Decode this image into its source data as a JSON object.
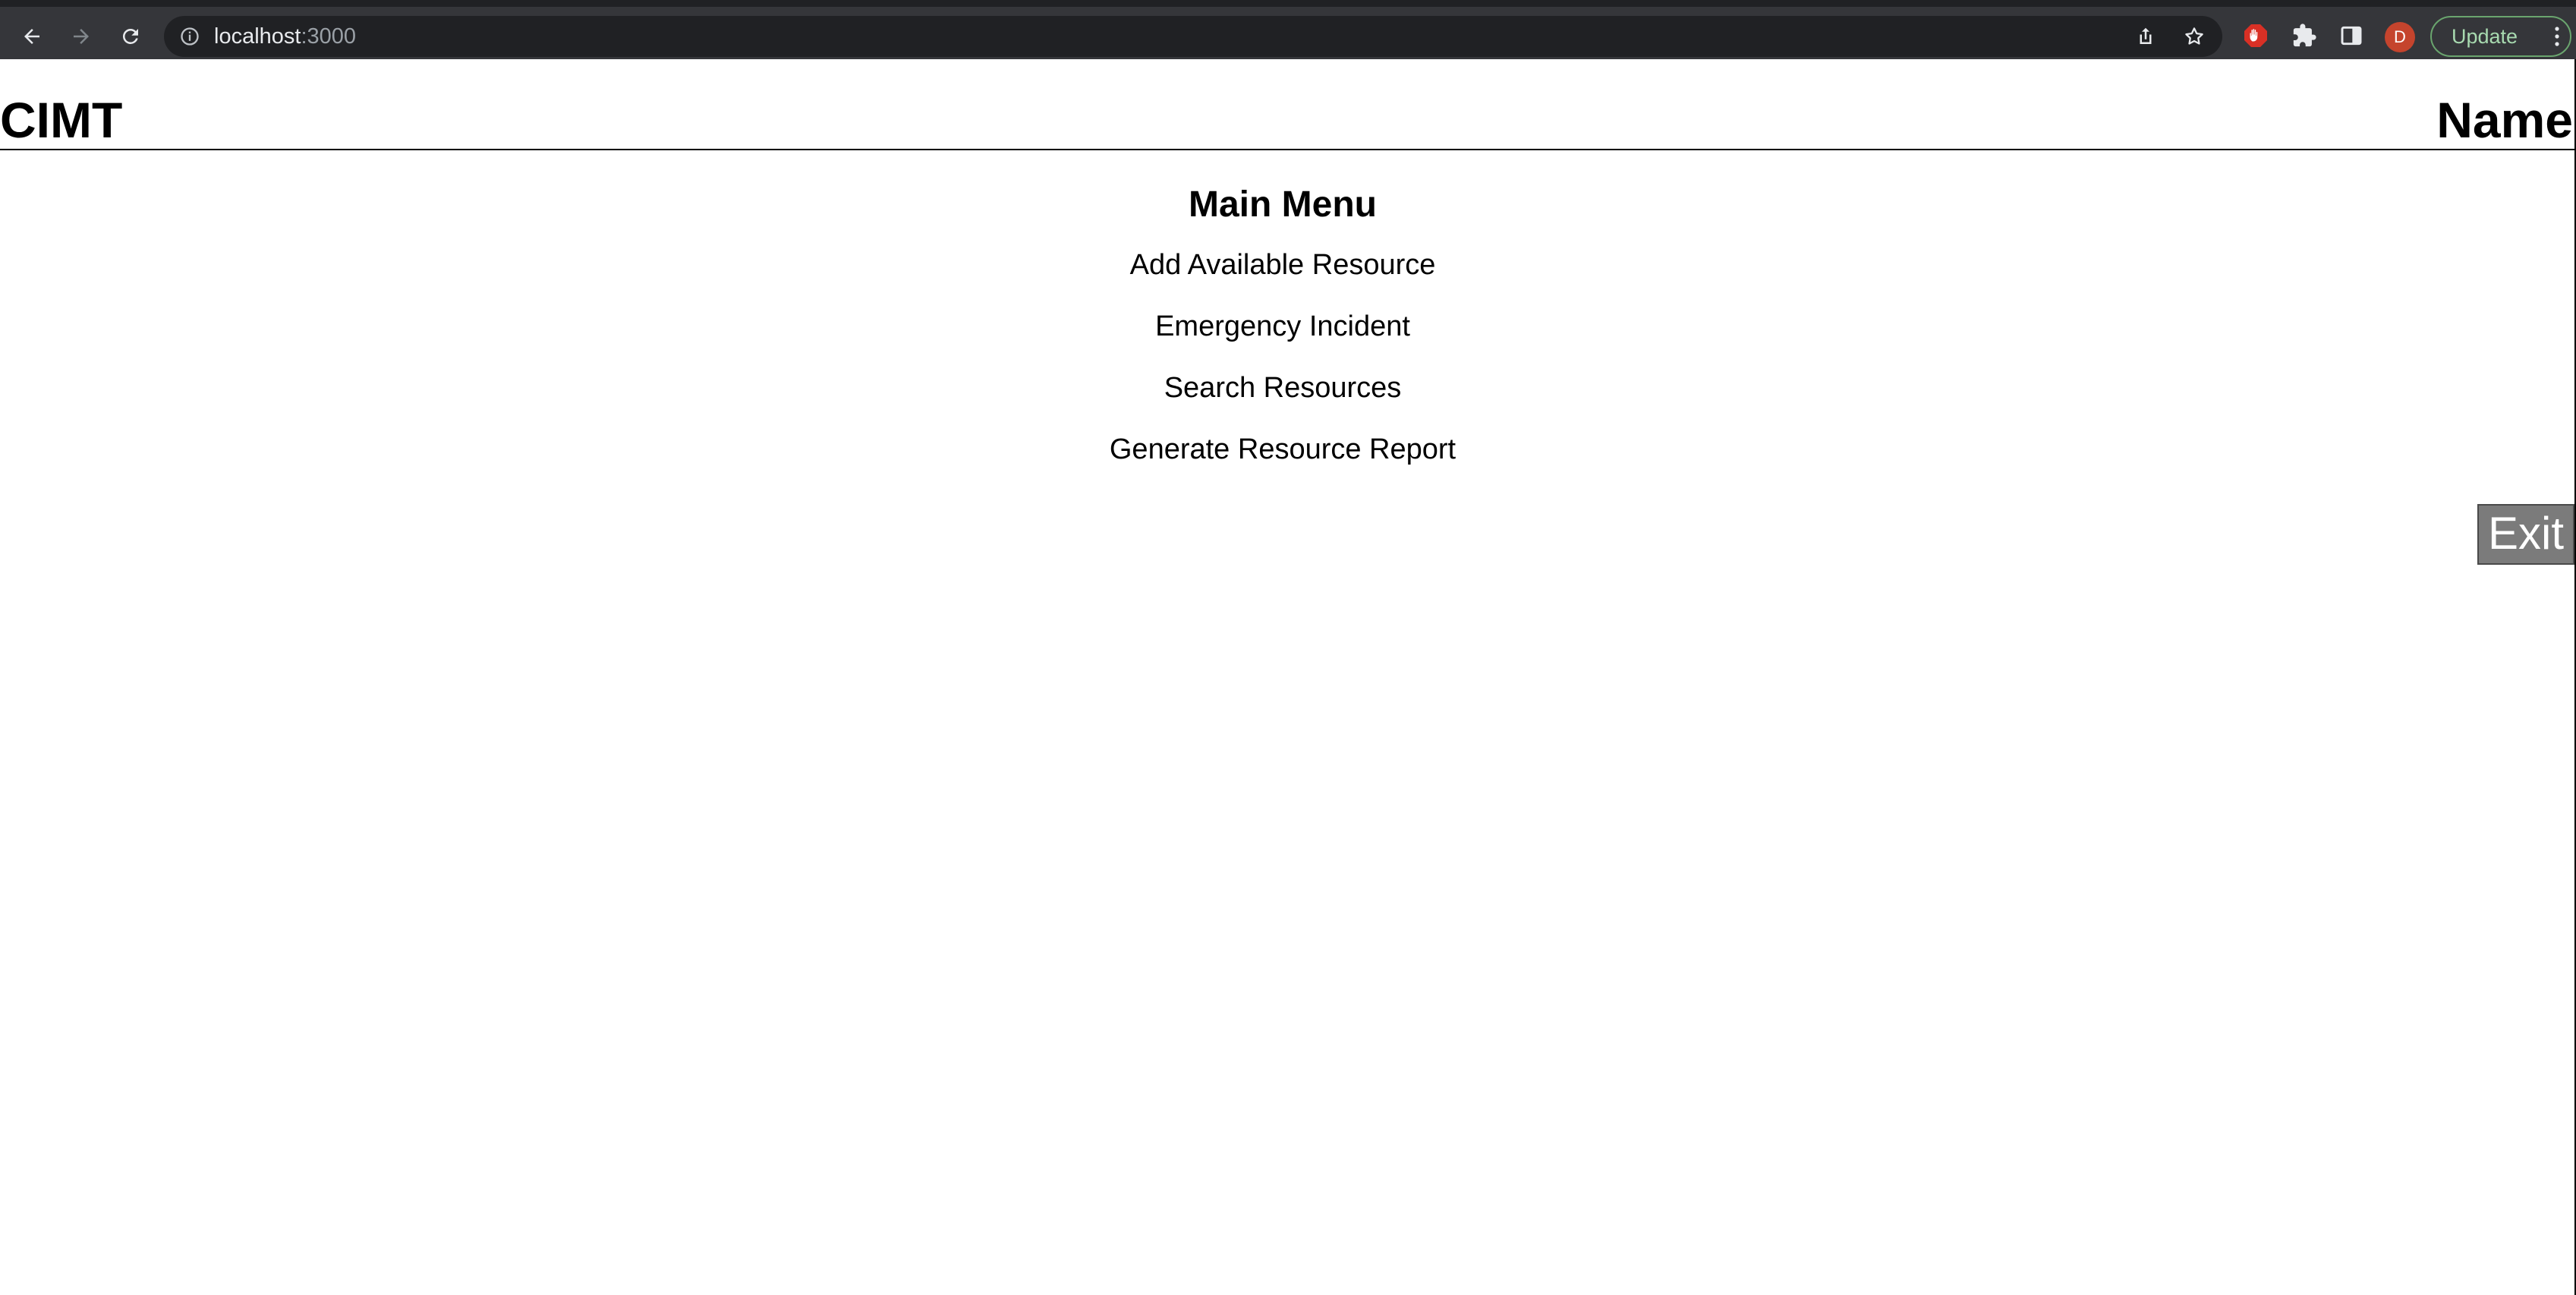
{
  "browser": {
    "url_host": "localhost",
    "url_port": ":3000",
    "update_label": "Update",
    "avatar_initial": "D",
    "icons": {
      "back": "back-arrow-icon",
      "forward": "forward-arrow-icon",
      "reload": "reload-icon",
      "site_info": "info-icon",
      "share": "share-icon",
      "bookmark": "star-icon",
      "adblock": "stop-hand-icon",
      "extensions": "puzzle-icon",
      "side_panel": "side-panel-icon",
      "menu": "kebab-menu-icon"
    },
    "colors": {
      "chrome_bg": "#35363a",
      "omnibox_bg": "#202124",
      "update_border": "#6aa56e",
      "avatar_bg": "#c5442d",
      "adblock_red": "#d93025"
    }
  },
  "header": {
    "app_title": "CIMT",
    "user_name": "Name"
  },
  "main_menu": {
    "title": "Main Menu",
    "items": [
      {
        "label": "Add Available Resource"
      },
      {
        "label": "Emergency Incident"
      },
      {
        "label": "Search Resources"
      },
      {
        "label": "Generate Resource Report"
      }
    ]
  },
  "exit_button": {
    "label": "Exit",
    "color": "#7b7b7b"
  }
}
